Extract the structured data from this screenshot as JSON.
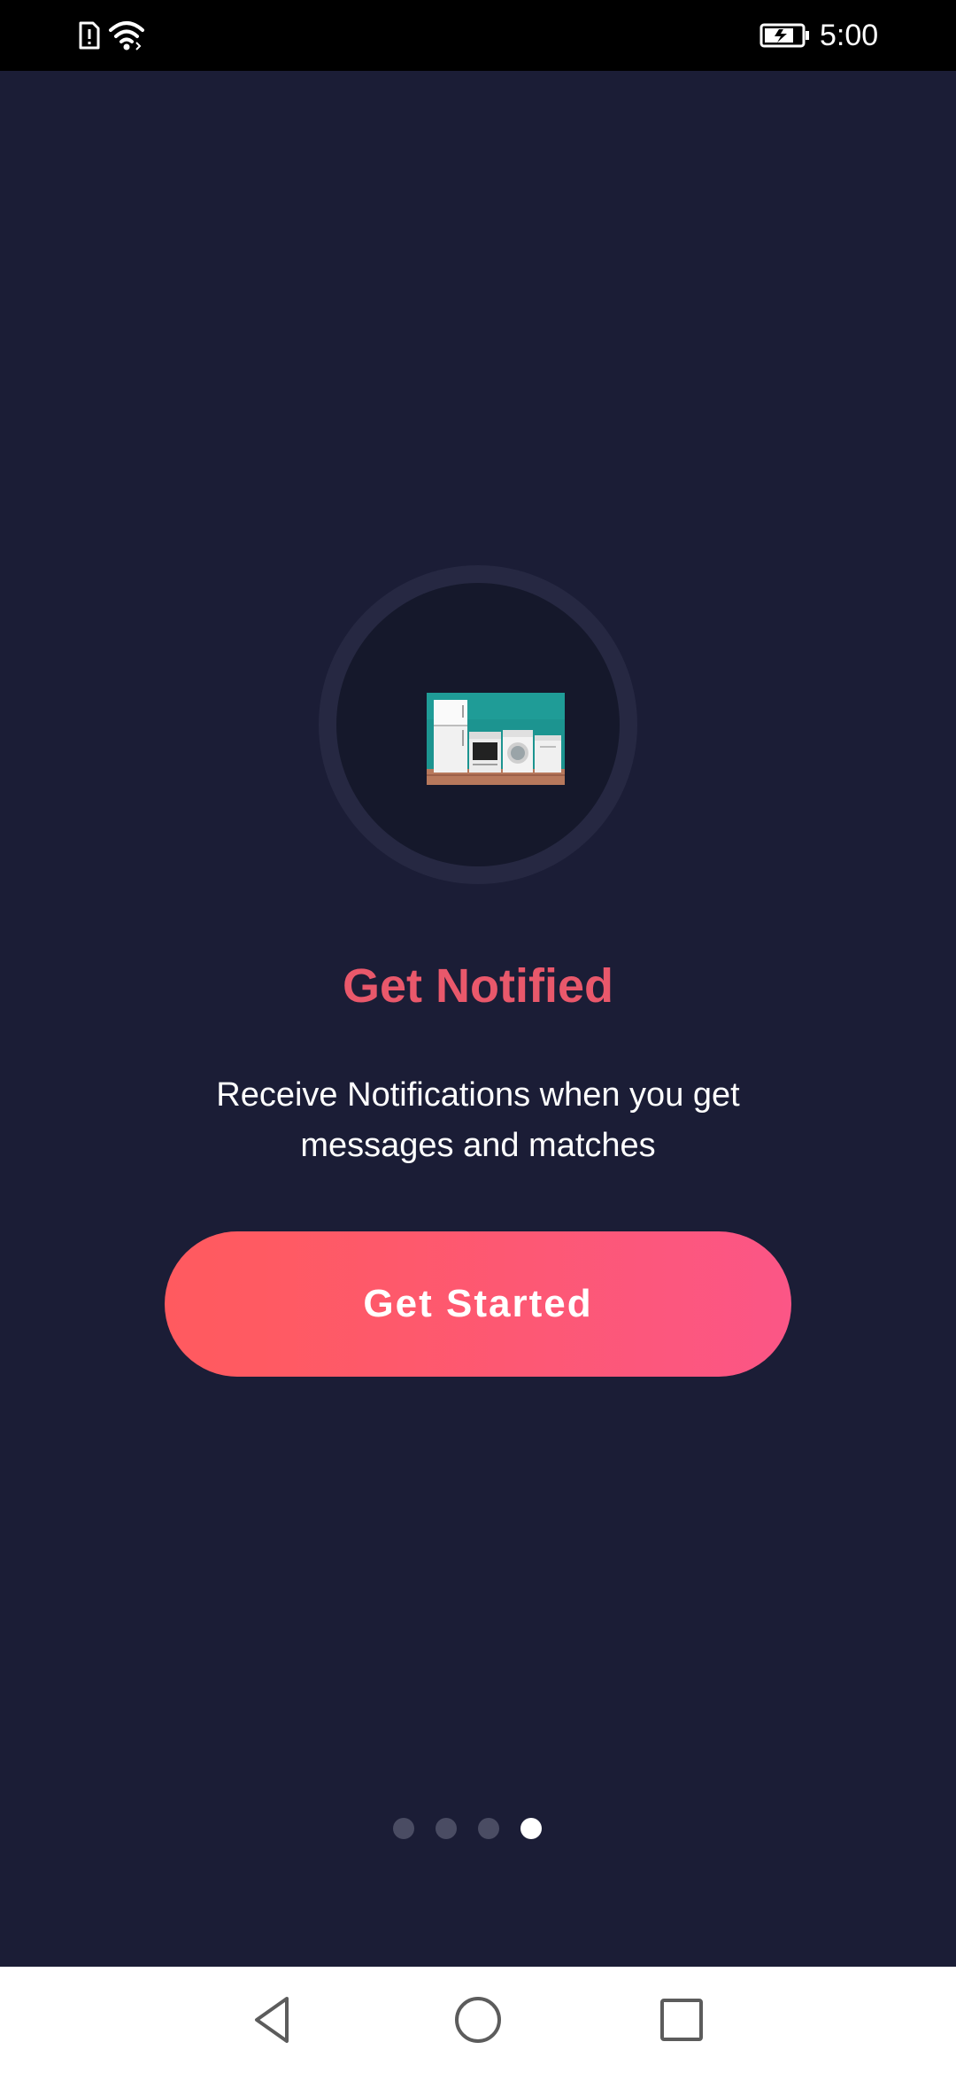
{
  "status_bar": {
    "time": "5:00",
    "icons": [
      "sim-alert-icon",
      "wifi-icon",
      "battery-charging-icon"
    ]
  },
  "onboarding": {
    "image": "home-appliances-image",
    "title": "Get Notified",
    "description": "Receive Notifications when you get messages and matches",
    "button_label": "Get Started"
  },
  "page_indicator": {
    "total": 4,
    "active_index": 3
  },
  "navigation_bar": {
    "buttons": [
      "back-icon",
      "home-icon",
      "recents-icon"
    ]
  },
  "colors": {
    "background": "#1b1d36",
    "title": "#e9586b",
    "button_gradient_start": "#ff5a5f",
    "button_gradient_end": "#fb5686",
    "indicator_inactive": "#4a4c63",
    "indicator_active": "#ffffff"
  }
}
